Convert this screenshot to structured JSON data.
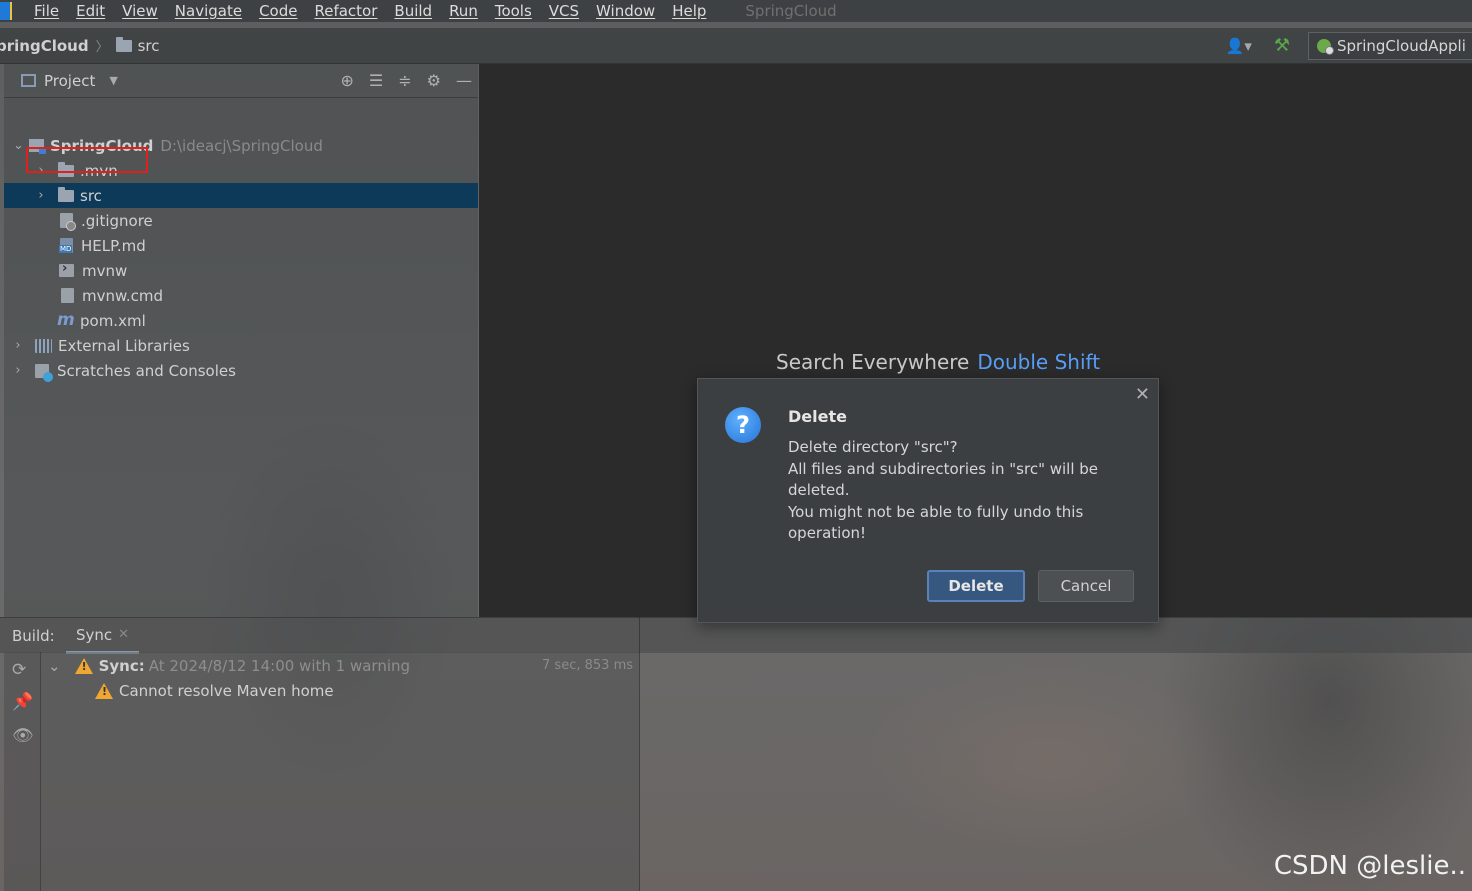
{
  "menu": {
    "items": [
      "File",
      "Edit",
      "View",
      "Navigate",
      "Code",
      "Refactor",
      "Build",
      "Run",
      "Tools",
      "VCS",
      "Window",
      "Help"
    ],
    "window_title": "SpringCloud"
  },
  "breadcrumb": {
    "root": "pringCloud",
    "child": "src"
  },
  "toolbar": {
    "run_config": "SpringCloudAppli"
  },
  "project_panel": {
    "title": "Project",
    "tree": [
      {
        "label": "SpringCloud",
        "path": "D:\\ideacj\\SpringCloud"
      },
      {
        "label": ".mvn"
      },
      {
        "label": "src"
      },
      {
        "label": ".gitignore"
      },
      {
        "label": "HELP.md"
      },
      {
        "label": "mvnw"
      },
      {
        "label": "mvnw.cmd"
      },
      {
        "label": "pom.xml"
      },
      {
        "label": "External Libraries"
      },
      {
        "label": "Scratches and Consoles"
      }
    ]
  },
  "editor": {
    "hint_text": "Search Everywhere",
    "hint_shortcut": "Double Shift"
  },
  "dialog": {
    "title": "Delete",
    "line1": "Delete directory \"src\"?",
    "line2": "All files and subdirectories in \"src\" will be deleted.",
    "line3": "You might not be able to fully undo this operation!",
    "delete_label": "Delete",
    "cancel_label": "Cancel"
  },
  "build": {
    "label": "Build:",
    "tab": "Sync",
    "sync_title": "Sync:",
    "sync_desc": "At 2024/8/12 14:00 with 1 warning",
    "sync_time": "7 sec, 853 ms",
    "warning": "Cannot resolve Maven home"
  },
  "watermark": "CSDN @leslie.."
}
